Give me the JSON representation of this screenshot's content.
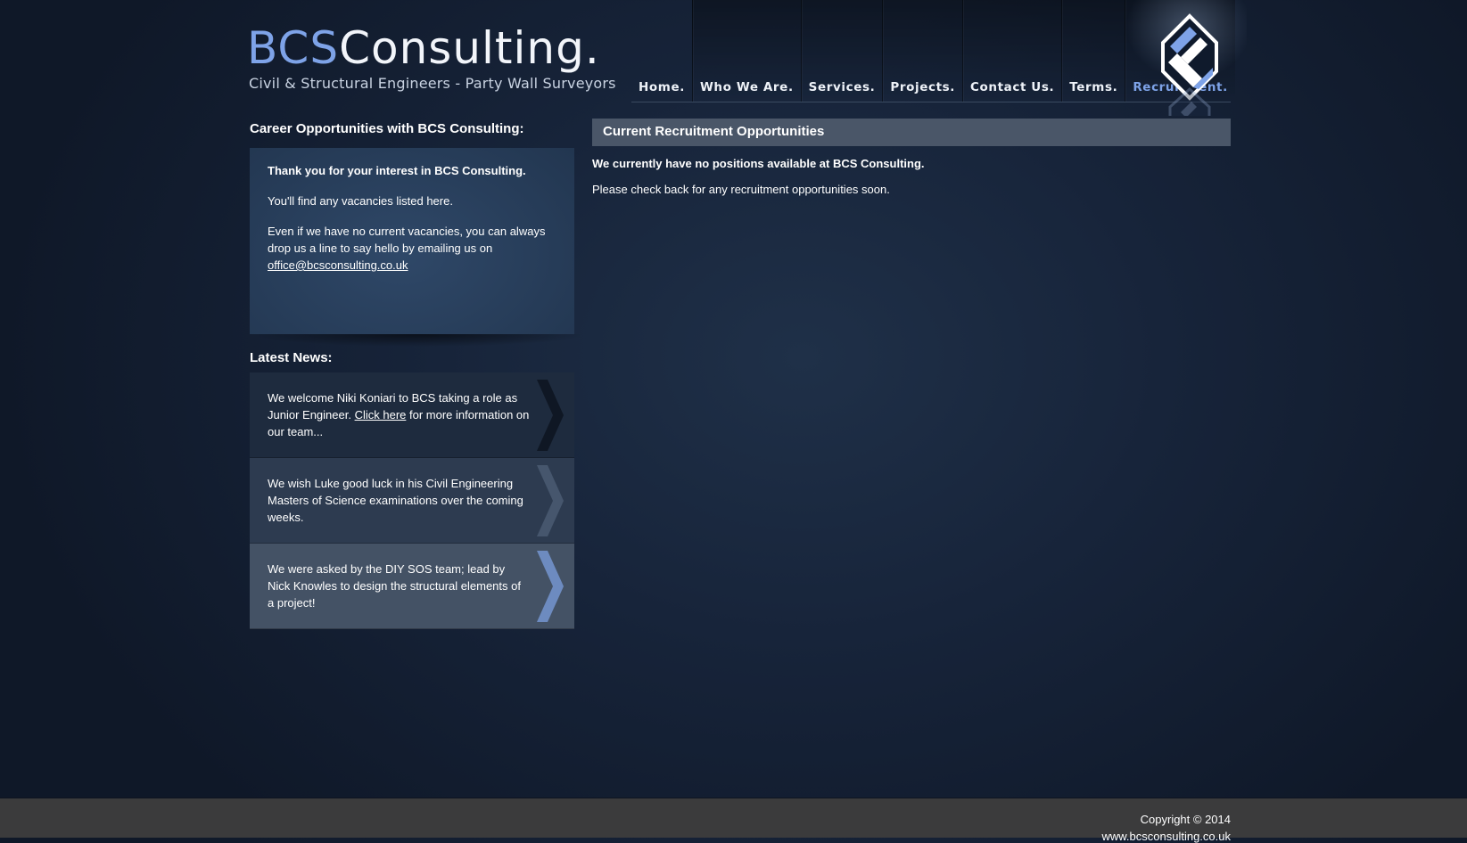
{
  "brand": {
    "bcs": "BCS",
    "consulting": "Consulting.",
    "tagline": "Civil & Structural Engineers - Party Wall Surveyors"
  },
  "nav": [
    {
      "label": "Home.",
      "active": false
    },
    {
      "label": "Who We Are.",
      "active": false
    },
    {
      "label": "Services.",
      "active": false
    },
    {
      "label": "Projects.",
      "active": false
    },
    {
      "label": "Contact Us.",
      "active": false
    },
    {
      "label": "Terms.",
      "active": false
    },
    {
      "label": "Recruitment.",
      "active": true
    }
  ],
  "career": {
    "title": "Career Opportunities with BCS Consulting:",
    "thanks": "Thank you for your interest in BCS Consulting.",
    "vacancies": "You'll find any vacancies listed here.",
    "even_if": "Even if we have no current vacancies, you can always drop us a line to say hello by emailing us on",
    "email": "office@bcsconsulting.co.uk"
  },
  "news": {
    "title": "Latest News:",
    "items": [
      {
        "before": "We welcome Niki Koniari to BCS taking a role as Junior Engineer. ",
        "link": "Click here",
        "after": " for more information on our team..."
      },
      {
        "text": "We wish Luke good luck in his Civil Engineering Masters of Science examinations over the coming weeks."
      },
      {
        "text": "We were asked by the DIY SOS team; lead by Nick Knowles to design the structural elements of a project!"
      }
    ]
  },
  "recruitment": {
    "header": "Current Recruitment Opportunities",
    "line1": "We currently have no positions available at BCS Consulting.",
    "line2": "Please check back for any recruitment opportunities soon."
  },
  "footer": {
    "copyright": "Copyright © 2014",
    "url": "www.bcsconsulting.co.uk"
  },
  "colors": {
    "accent": "#7ea3e8",
    "background": "#17243a",
    "footer": "#3b3b3c",
    "header_bar": "#4a5668"
  }
}
